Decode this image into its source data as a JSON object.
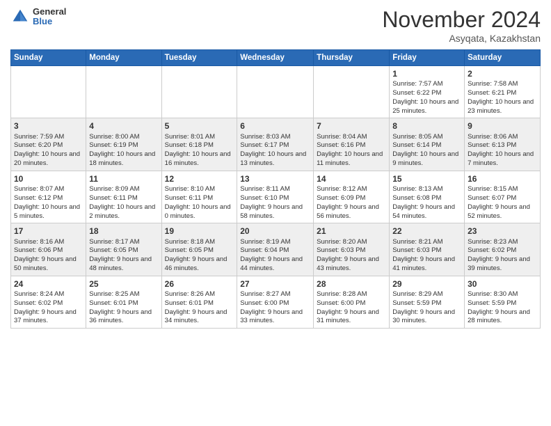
{
  "logo": {
    "general": "General",
    "blue": "Blue"
  },
  "header": {
    "title": "November 2024",
    "location": "Asyqata, Kazakhstan"
  },
  "weekdays": [
    "Sunday",
    "Monday",
    "Tuesday",
    "Wednesday",
    "Thursday",
    "Friday",
    "Saturday"
  ],
  "weeks": [
    [
      {
        "day": "",
        "info": ""
      },
      {
        "day": "",
        "info": ""
      },
      {
        "day": "",
        "info": ""
      },
      {
        "day": "",
        "info": ""
      },
      {
        "day": "",
        "info": ""
      },
      {
        "day": "1",
        "info": "Sunrise: 7:57 AM\nSunset: 6:22 PM\nDaylight: 10 hours and 25 minutes."
      },
      {
        "day": "2",
        "info": "Sunrise: 7:58 AM\nSunset: 6:21 PM\nDaylight: 10 hours and 23 minutes."
      }
    ],
    [
      {
        "day": "3",
        "info": "Sunrise: 7:59 AM\nSunset: 6:20 PM\nDaylight: 10 hours and 20 minutes."
      },
      {
        "day": "4",
        "info": "Sunrise: 8:00 AM\nSunset: 6:19 PM\nDaylight: 10 hours and 18 minutes."
      },
      {
        "day": "5",
        "info": "Sunrise: 8:01 AM\nSunset: 6:18 PM\nDaylight: 10 hours and 16 minutes."
      },
      {
        "day": "6",
        "info": "Sunrise: 8:03 AM\nSunset: 6:17 PM\nDaylight: 10 hours and 13 minutes."
      },
      {
        "day": "7",
        "info": "Sunrise: 8:04 AM\nSunset: 6:16 PM\nDaylight: 10 hours and 11 minutes."
      },
      {
        "day": "8",
        "info": "Sunrise: 8:05 AM\nSunset: 6:14 PM\nDaylight: 10 hours and 9 minutes."
      },
      {
        "day": "9",
        "info": "Sunrise: 8:06 AM\nSunset: 6:13 PM\nDaylight: 10 hours and 7 minutes."
      }
    ],
    [
      {
        "day": "10",
        "info": "Sunrise: 8:07 AM\nSunset: 6:12 PM\nDaylight: 10 hours and 5 minutes."
      },
      {
        "day": "11",
        "info": "Sunrise: 8:09 AM\nSunset: 6:11 PM\nDaylight: 10 hours and 2 minutes."
      },
      {
        "day": "12",
        "info": "Sunrise: 8:10 AM\nSunset: 6:11 PM\nDaylight: 10 hours and 0 minutes."
      },
      {
        "day": "13",
        "info": "Sunrise: 8:11 AM\nSunset: 6:10 PM\nDaylight: 9 hours and 58 minutes."
      },
      {
        "day": "14",
        "info": "Sunrise: 8:12 AM\nSunset: 6:09 PM\nDaylight: 9 hours and 56 minutes."
      },
      {
        "day": "15",
        "info": "Sunrise: 8:13 AM\nSunset: 6:08 PM\nDaylight: 9 hours and 54 minutes."
      },
      {
        "day": "16",
        "info": "Sunrise: 8:15 AM\nSunset: 6:07 PM\nDaylight: 9 hours and 52 minutes."
      }
    ],
    [
      {
        "day": "17",
        "info": "Sunrise: 8:16 AM\nSunset: 6:06 PM\nDaylight: 9 hours and 50 minutes."
      },
      {
        "day": "18",
        "info": "Sunrise: 8:17 AM\nSunset: 6:05 PM\nDaylight: 9 hours and 48 minutes."
      },
      {
        "day": "19",
        "info": "Sunrise: 8:18 AM\nSunset: 6:05 PM\nDaylight: 9 hours and 46 minutes."
      },
      {
        "day": "20",
        "info": "Sunrise: 8:19 AM\nSunset: 6:04 PM\nDaylight: 9 hours and 44 minutes."
      },
      {
        "day": "21",
        "info": "Sunrise: 8:20 AM\nSunset: 6:03 PM\nDaylight: 9 hours and 43 minutes."
      },
      {
        "day": "22",
        "info": "Sunrise: 8:21 AM\nSunset: 6:03 PM\nDaylight: 9 hours and 41 minutes."
      },
      {
        "day": "23",
        "info": "Sunrise: 8:23 AM\nSunset: 6:02 PM\nDaylight: 9 hours and 39 minutes."
      }
    ],
    [
      {
        "day": "24",
        "info": "Sunrise: 8:24 AM\nSunset: 6:02 PM\nDaylight: 9 hours and 37 minutes."
      },
      {
        "day": "25",
        "info": "Sunrise: 8:25 AM\nSunset: 6:01 PM\nDaylight: 9 hours and 36 minutes."
      },
      {
        "day": "26",
        "info": "Sunrise: 8:26 AM\nSunset: 6:01 PM\nDaylight: 9 hours and 34 minutes."
      },
      {
        "day": "27",
        "info": "Sunrise: 8:27 AM\nSunset: 6:00 PM\nDaylight: 9 hours and 33 minutes."
      },
      {
        "day": "28",
        "info": "Sunrise: 8:28 AM\nSunset: 6:00 PM\nDaylight: 9 hours and 31 minutes."
      },
      {
        "day": "29",
        "info": "Sunrise: 8:29 AM\nSunset: 5:59 PM\nDaylight: 9 hours and 30 minutes."
      },
      {
        "day": "30",
        "info": "Sunrise: 8:30 AM\nSunset: 5:59 PM\nDaylight: 9 hours and 28 minutes."
      }
    ]
  ]
}
